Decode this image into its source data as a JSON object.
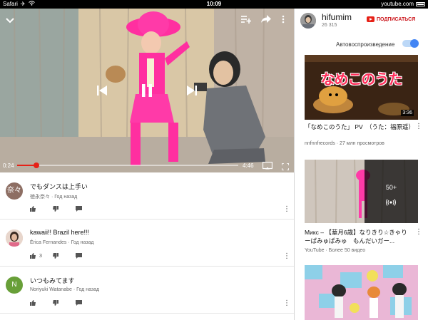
{
  "status_bar": {
    "app": "Safari",
    "time": "10:09",
    "url": "youtube.com"
  },
  "player": {
    "current_time": "0:24",
    "duration": "4:46",
    "progress": 0.088
  },
  "comments": [
    {
      "avatar_text": "奈々",
      "avatar_color": "#8d6e63",
      "text": "でもダンスは上手い",
      "author": "徳永奈々",
      "age": "Год назад",
      "likes": ""
    },
    {
      "avatar_text": "",
      "avatar_color": "#d9b8a8",
      "text": "kawaii!! Brazil here!!!",
      "author": "Érica Fernandes",
      "age": "Год назад",
      "likes": "3"
    },
    {
      "avatar_text": "N",
      "avatar_color": "#689f38",
      "text": "いつもみてます",
      "author": "Noriyuki Watanabe",
      "age": "Год назад",
      "likes": ""
    }
  ],
  "channel": {
    "name": "hifumim",
    "subscribers": "26 315",
    "subscribe_label": "ПОДПИСАТЬСЯ"
  },
  "autoplay": {
    "label": "Автовоспроизведение",
    "enabled": true
  },
  "related": [
    {
      "title": "「なめこのうた」 PV　（うた：福原遥）",
      "channel": "nnfnnfrecords",
      "views": "27 млн просмотров",
      "duration": "3:36",
      "thumb_text": "なめこのうた"
    },
    {
      "title": "Микс – 【華月6歳】なりきり☆きゃりーぱみゅぱみゅ　もんだいガー...",
      "channel": "YouTube",
      "views": "Более 50 видео",
      "mix_count": "50+"
    },
    {
      "title": "",
      "channel": "",
      "views": ""
    }
  ],
  "colors": {
    "accent_red": "#e62117",
    "toggle_blue": "#4285f4"
  }
}
